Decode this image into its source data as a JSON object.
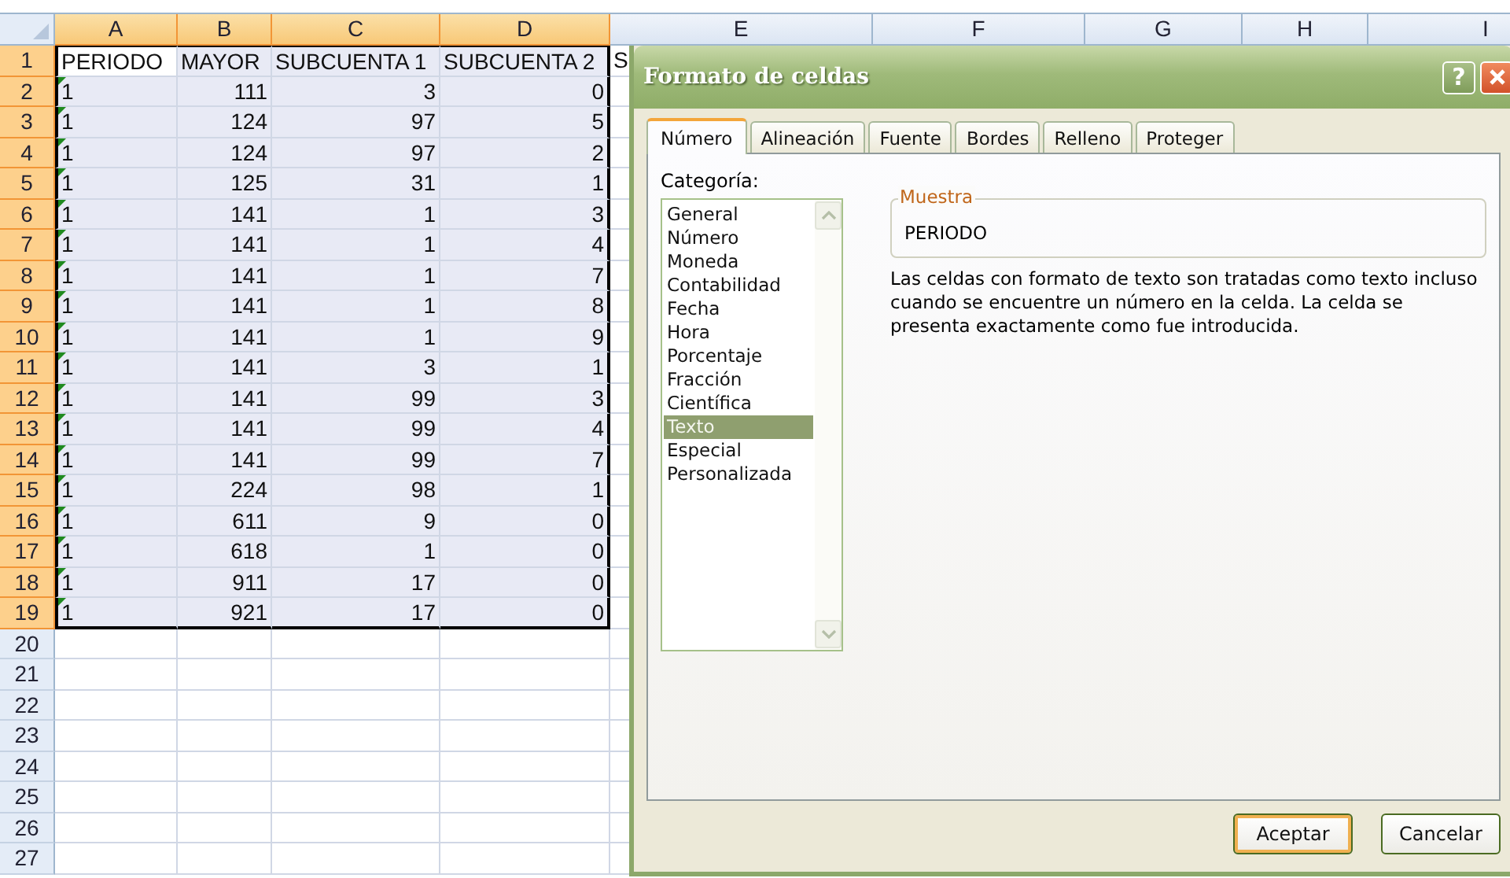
{
  "sheet": {
    "columns": [
      {
        "label": "A",
        "selected": true
      },
      {
        "label": "B",
        "selected": true
      },
      {
        "label": "C",
        "selected": true
      },
      {
        "label": "D",
        "selected": true
      },
      {
        "label": "E",
        "selected": false
      },
      {
        "label": "F",
        "selected": false
      },
      {
        "label": "G",
        "selected": false
      },
      {
        "label": "H",
        "selected": false
      },
      {
        "label": "I",
        "selected": false
      }
    ],
    "rows": [
      {
        "header": "1",
        "selected": true,
        "active": true,
        "flagged": false,
        "cells": [
          "PERIODO",
          "MAYOR",
          "SUBCUENTA 1",
          "SUBCUENTA 2",
          "S"
        ]
      },
      {
        "header": "2",
        "selected": true,
        "active": false,
        "flagged": true,
        "cells": [
          "1",
          "111",
          "3",
          "0"
        ]
      },
      {
        "header": "3",
        "selected": true,
        "active": false,
        "flagged": true,
        "cells": [
          "1",
          "124",
          "97",
          "5"
        ]
      },
      {
        "header": "4",
        "selected": true,
        "active": false,
        "flagged": true,
        "cells": [
          "1",
          "124",
          "97",
          "2"
        ]
      },
      {
        "header": "5",
        "selected": true,
        "active": false,
        "flagged": true,
        "cells": [
          "1",
          "125",
          "31",
          "1"
        ]
      },
      {
        "header": "6",
        "selected": true,
        "active": false,
        "flagged": true,
        "cells": [
          "1",
          "141",
          "1",
          "3"
        ]
      },
      {
        "header": "7",
        "selected": true,
        "active": false,
        "flagged": true,
        "cells": [
          "1",
          "141",
          "1",
          "4"
        ]
      },
      {
        "header": "8",
        "selected": true,
        "active": false,
        "flagged": true,
        "cells": [
          "1",
          "141",
          "1",
          "7"
        ]
      },
      {
        "header": "9",
        "selected": true,
        "active": false,
        "flagged": true,
        "cells": [
          "1",
          "141",
          "1",
          "8"
        ]
      },
      {
        "header": "10",
        "selected": true,
        "active": false,
        "flagged": true,
        "cells": [
          "1",
          "141",
          "1",
          "9"
        ]
      },
      {
        "header": "11",
        "selected": true,
        "active": false,
        "flagged": true,
        "cells": [
          "1",
          "141",
          "3",
          "1"
        ]
      },
      {
        "header": "12",
        "selected": true,
        "active": false,
        "flagged": true,
        "cells": [
          "1",
          "141",
          "99",
          "3"
        ]
      },
      {
        "header": "13",
        "selected": true,
        "active": false,
        "flagged": true,
        "cells": [
          "1",
          "141",
          "99",
          "4"
        ]
      },
      {
        "header": "14",
        "selected": true,
        "active": false,
        "flagged": true,
        "cells": [
          "1",
          "141",
          "99",
          "7"
        ]
      },
      {
        "header": "15",
        "selected": true,
        "active": false,
        "flagged": true,
        "cells": [
          "1",
          "224",
          "98",
          "1"
        ]
      },
      {
        "header": "16",
        "selected": true,
        "active": false,
        "flagged": true,
        "cells": [
          "1",
          "611",
          "9",
          "0"
        ]
      },
      {
        "header": "17",
        "selected": true,
        "active": false,
        "flagged": true,
        "cells": [
          "1",
          "618",
          "1",
          "0"
        ]
      },
      {
        "header": "18",
        "selected": true,
        "active": false,
        "flagged": true,
        "cells": [
          "1",
          "911",
          "17",
          "0"
        ]
      },
      {
        "header": "19",
        "selected": true,
        "active": false,
        "flagged": true,
        "cells": [
          "1",
          "921",
          "17",
          "0"
        ]
      },
      {
        "header": "20",
        "selected": false,
        "active": false,
        "flagged": false
      },
      {
        "header": "21",
        "selected": false,
        "active": false,
        "flagged": false
      },
      {
        "header": "22",
        "selected": false,
        "active": false,
        "flagged": false
      },
      {
        "header": "23",
        "selected": false,
        "active": false,
        "flagged": false
      },
      {
        "header": "24",
        "selected": false,
        "active": false,
        "flagged": false
      },
      {
        "header": "25",
        "selected": false,
        "active": false,
        "flagged": false
      },
      {
        "header": "26",
        "selected": false,
        "active": false,
        "flagged": false
      },
      {
        "header": "27",
        "selected": false,
        "active": false,
        "flagged": false
      }
    ]
  },
  "dialog": {
    "title": "Formato de celdas",
    "help": "?",
    "tabs": [
      {
        "label": "Número",
        "selected": true
      },
      {
        "label": "Alineación",
        "selected": false
      },
      {
        "label": "Fuente",
        "selected": false
      },
      {
        "label": "Bordes",
        "selected": false
      },
      {
        "label": "Relleno",
        "selected": false
      },
      {
        "label": "Proteger",
        "selected": false
      }
    ],
    "category_label": "Categoría:",
    "categories": [
      {
        "label": "General",
        "selected": false
      },
      {
        "label": "Número",
        "selected": false
      },
      {
        "label": "Moneda",
        "selected": false
      },
      {
        "label": "Contabilidad",
        "selected": false
      },
      {
        "label": "Fecha",
        "selected": false
      },
      {
        "label": "Hora",
        "selected": false
      },
      {
        "label": "Porcentaje",
        "selected": false
      },
      {
        "label": "Fracción",
        "selected": false
      },
      {
        "label": "Científica",
        "selected": false
      },
      {
        "label": "Texto",
        "selected": true
      },
      {
        "label": "Especial",
        "selected": false
      },
      {
        "label": "Personalizada",
        "selected": false
      }
    ],
    "sample": {
      "label": "Muestra",
      "value": "PERIODO"
    },
    "description": "Las celdas con formato de texto son tratadas como texto incluso cuando se encuentre un número en la celda. La celda se presenta exactamente como fue introducida.",
    "buttons": [
      {
        "label": "Aceptar",
        "default": true
      },
      {
        "label": "Cancelar",
        "default": false
      }
    ]
  }
}
